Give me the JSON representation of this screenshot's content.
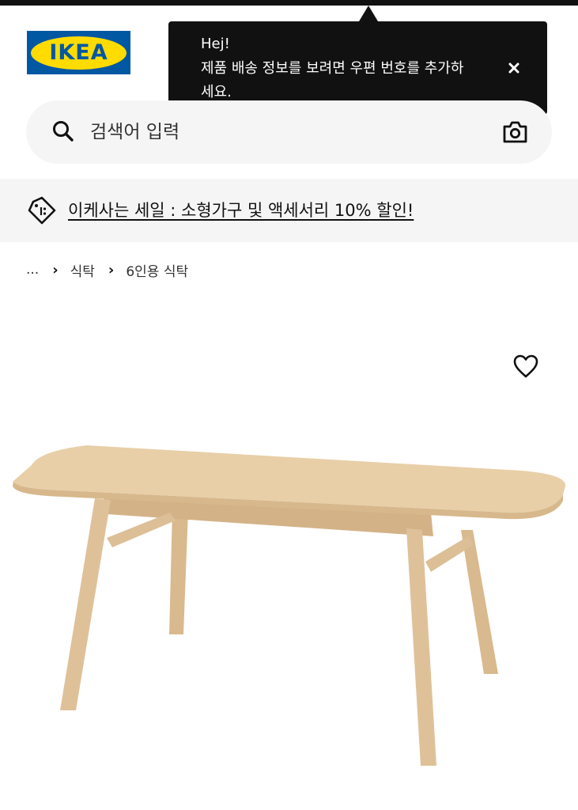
{
  "brand": {
    "logo_text": "IKEA"
  },
  "tooltip": {
    "title": "Hej!",
    "message": "제품 배송 정보를 보려면 우편 번호를 추가하세요."
  },
  "search": {
    "placeholder": "검색어 입력",
    "value": ""
  },
  "promo": {
    "text": "이케사는 세일 : 소형가구 및 액세서리 10% 할인!"
  },
  "breadcrumb": {
    "items": [
      "...",
      "식탁",
      "6인용 식탁"
    ],
    "separator": "›"
  },
  "product": {
    "image_subject": "light wood dining table"
  },
  "icons": {
    "search": "search-icon",
    "camera": "camera-icon",
    "close": "close-icon",
    "promo": "price-tag-icon",
    "wishlist": "heart-icon"
  },
  "colors": {
    "ikea_blue": "#0058a3",
    "ikea_yellow": "#ffdb00",
    "tooltip_bg": "#111111",
    "surface_gray": "#f5f5f5"
  }
}
